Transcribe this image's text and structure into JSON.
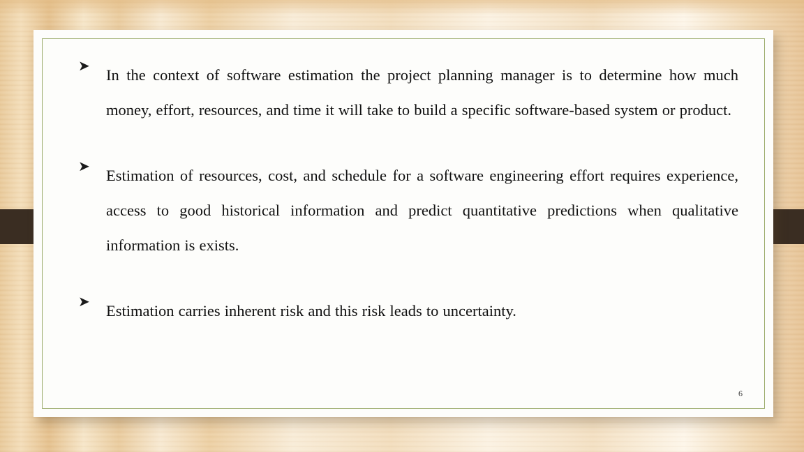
{
  "slide": {
    "number": "6",
    "bullet_glyph": "➤",
    "bullets": [
      {
        "id": "bullet-1",
        "text": "In the context of software estimation the project planning manager is to determine how  much money, effort, resources, and time it will take to build a specific software-based system or product."
      },
      {
        "id": "bullet-2",
        "text": "Estimation of resources, cost, and schedule for a software engineering effort requires experience, access to good historical information and predict quantitative predictions when qualitative information is exists."
      },
      {
        "id": "bullet-3",
        "text": "Estimation carries inherent risk and this risk leads to uncertainty."
      }
    ]
  },
  "theme": {
    "background_wood": "#f0d8b4",
    "card_background": "#fdfdfb",
    "inner_border_color": "#9aab6a",
    "tab_color": "#3a2d22",
    "text_color": "#111111"
  }
}
